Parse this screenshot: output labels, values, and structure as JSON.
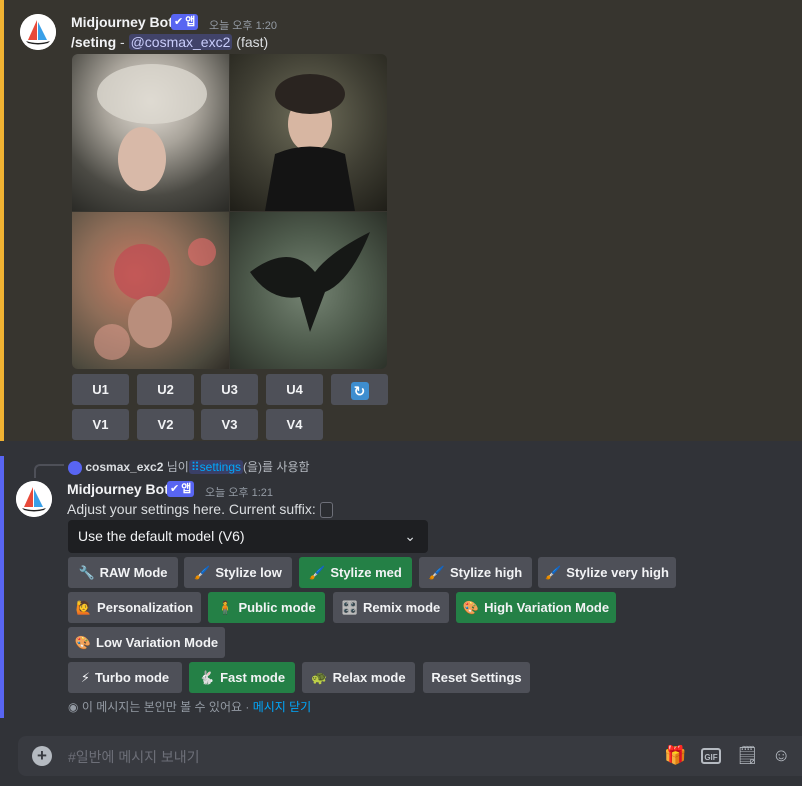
{
  "message1": {
    "bot_name": "Midjourney Bot",
    "badge": "앱",
    "timestamp": "오늘 오후 1:20",
    "command": "/seting",
    "separator": " - ",
    "mention": "@cosmax_exc2",
    "speed": "(fast)",
    "buttons_row1": [
      "U1",
      "U2",
      "U3",
      "U4"
    ],
    "refresh_icon": "refresh-icon",
    "buttons_row2": [
      "V1",
      "V2",
      "V3",
      "V4"
    ]
  },
  "reply": {
    "user": "cosmax_exc2",
    "text_before": "님이",
    "command": "settings",
    "text_after": "(을)를 사용함"
  },
  "message2": {
    "bot_name": "Midjourney Bot",
    "badge": "앱",
    "timestamp": "오늘 오후 1:21",
    "text": "Adjust your settings here. Current suffix:",
    "select_value": "Use the default model (V6)",
    "row1": [
      {
        "label": "RAW Mode",
        "icon": "🔧"
      },
      {
        "label": "Stylize low",
        "icon": "🖌️"
      },
      {
        "label": "Stylize med",
        "icon": "🖌️"
      },
      {
        "label": "Stylize high",
        "icon": "🖌️"
      },
      {
        "label": "Stylize very high",
        "icon": "🖌️"
      }
    ],
    "row2": [
      {
        "label": "Personalization",
        "icon": "🙋"
      },
      {
        "label": "Public mode",
        "icon": "🧍"
      },
      {
        "label": "Remix mode",
        "icon": "🎛️"
      },
      {
        "label": "High Variation Mode",
        "icon": "🎨"
      }
    ],
    "row3": [
      {
        "label": "Low Variation Mode",
        "icon": "🎨"
      }
    ],
    "row4": [
      {
        "label": "Turbo mode",
        "icon": "⚡"
      },
      {
        "label": "Fast mode",
        "icon": "🐇"
      },
      {
        "label": "Relax mode",
        "icon": "🐢"
      },
      {
        "label": "Reset Settings",
        "icon": ""
      }
    ],
    "ephemeral_note": "이 메시지는 본인만 볼 수 있어요 · ",
    "dismiss": "메시지 닫기"
  },
  "chat": {
    "placeholder": "#일반에 메시지 보내기"
  },
  "colors": {
    "accent": "#5865f2",
    "green": "#248046",
    "button": "#4e5058",
    "highlight_border": "#f0b232"
  }
}
